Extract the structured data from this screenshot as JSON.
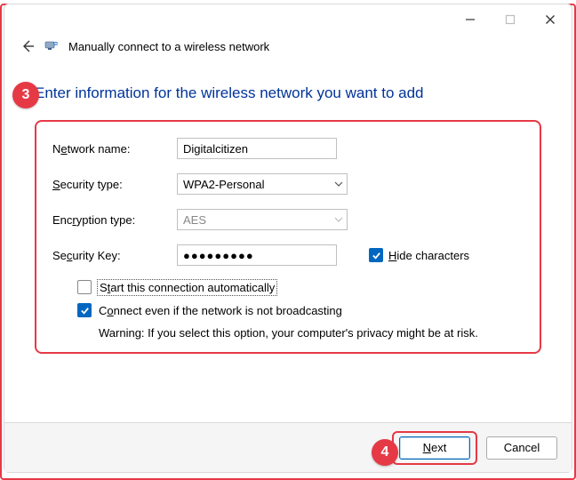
{
  "window": {
    "title": "Manually connect to a wireless network"
  },
  "headline": "Enter information for the wireless network you want to add",
  "form": {
    "network_name_label": "Network name:",
    "network_name_value": "Digitalcitizen",
    "security_type_label": "Security type:",
    "security_type_value": "WPA2-Personal",
    "encryption_type_label": "Encryption type:",
    "encryption_type_value": "AES",
    "security_key_label": "Security Key:",
    "security_key_value": "●●●●●●●●●",
    "hide_characters_label": "Hide characters",
    "start_auto_label": "Start this connection automatically",
    "connect_nonbroadcast_label": "Connect even if the network is not broadcasting",
    "warning": "Warning: If you select this option, your computer's privacy might be at risk."
  },
  "buttons": {
    "next": "Next",
    "cancel": "Cancel"
  },
  "annotations": {
    "step3": "3",
    "step4": "4"
  }
}
